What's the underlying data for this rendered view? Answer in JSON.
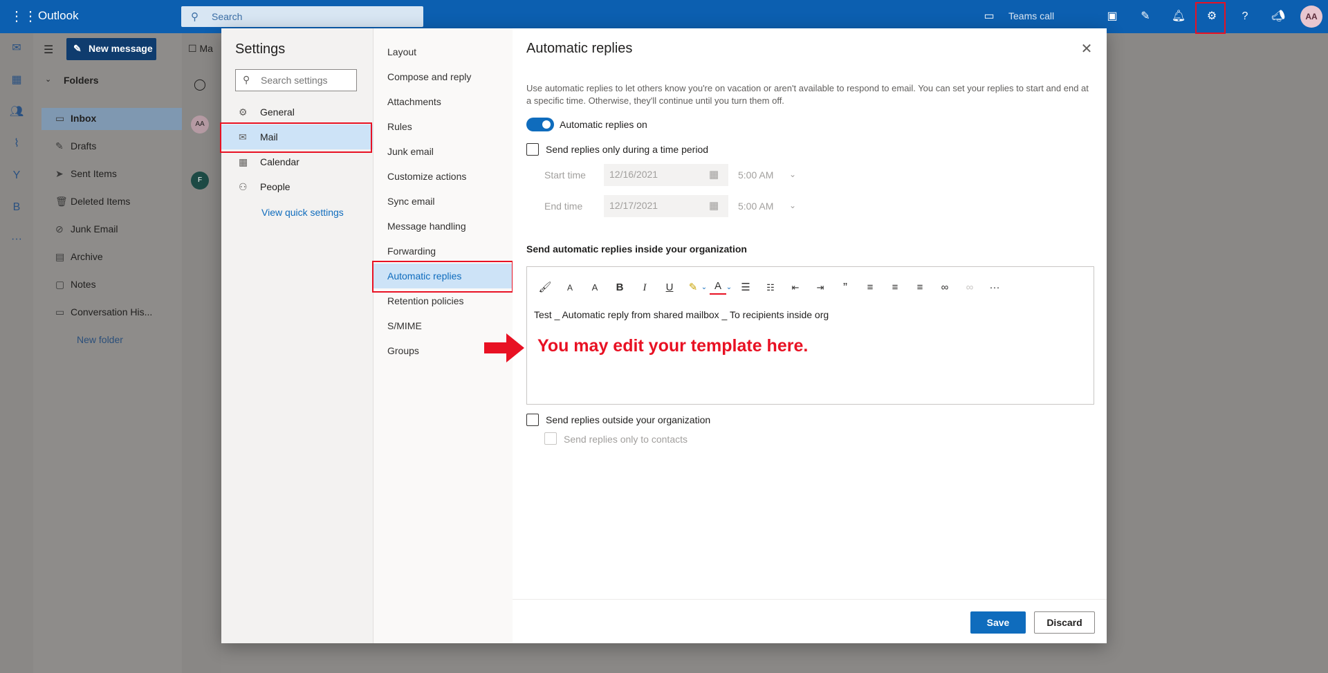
{
  "app": {
    "brand": "Outlook"
  },
  "topbar": {
    "search_placeholder": "Search",
    "teams_call": "Teams call",
    "avatar_initials": "AA"
  },
  "mail_pane": {
    "new_message": "New message",
    "folders_heading": "Folders",
    "folders": [
      "Inbox",
      "Drafts",
      "Sent Items",
      "Deleted Items",
      "Junk Email",
      "Archive",
      "Notes",
      "Conversation His...",
      "New folder"
    ],
    "tab_partial": "Ma",
    "list_avatar_1": "AA",
    "list_avatar_2": "F"
  },
  "settings": {
    "title": "Settings",
    "search_placeholder": "Search settings",
    "categories": [
      "General",
      "Mail",
      "Calendar",
      "People"
    ],
    "view_quick_settings": "View quick settings",
    "mail_subcategories": [
      "Layout",
      "Compose and reply",
      "Attachments",
      "Rules",
      "Junk email",
      "Customize actions",
      "Sync email",
      "Message handling",
      "Forwarding",
      "Automatic replies",
      "Retention policies",
      "S/MIME",
      "Groups"
    ]
  },
  "auto_replies": {
    "title": "Automatic replies",
    "description": "Use automatic replies to let others know you're on vacation or aren't available to respond to email. You can set your replies to start and end at a specific time. Otherwise, they'll continue until you turn them off.",
    "toggle_label": "Automatic replies on",
    "toggle_on": true,
    "time_period_label": "Send replies only during a time period",
    "start_label": "Start time",
    "start_date": "12/16/2021",
    "start_time": "5:00 AM",
    "end_label": "End time",
    "end_date": "12/17/2021",
    "end_time": "5:00 AM",
    "inside_heading": "Send automatic replies inside your organization",
    "editor_text": "Test _ Automatic reply from shared mailbox _ To recipients inside org",
    "annotation": "You may edit your template here.",
    "outside_label": "Send replies outside your organization",
    "contacts_label": "Send replies only to contacts",
    "save": "Save",
    "discard": "Discard"
  },
  "colors": {
    "brand_blue": "#0f6cbd",
    "annotation_red": "#e81123",
    "selected_bg": "#cde3f7"
  }
}
